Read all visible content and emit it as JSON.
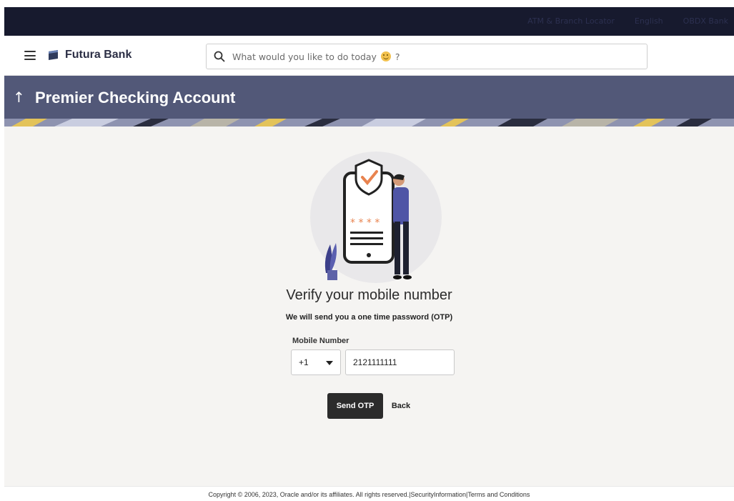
{
  "topbar": {
    "items": [
      "ATM & Branch Locator",
      "English",
      "OBDX Bank"
    ]
  },
  "header": {
    "brand": "Futura Bank",
    "search_placeholder_before": "What would you like to do today",
    "search_placeholder_after": "?"
  },
  "banner": {
    "back_glyph": "↑",
    "title": "Premier Checking Account"
  },
  "verify": {
    "heading": "Verify your mobile number",
    "subtext": "We will send you a one time password (OTP)",
    "mobile_label": "Mobile Number",
    "country_code": "+1",
    "mobile_value": "2121111111",
    "send_label": "Send OTP",
    "back_label": "Back",
    "otp_mask": "* * * *"
  },
  "footer": {
    "copyright": "Copyright © 2006, 2023, Oracle and/or its affiliates. All rights reserved.",
    "sep1": "|",
    "security": "SecurityInformation",
    "sep2": "|",
    "terms": "Terms and Conditions"
  },
  "colors": {
    "topbar": "#171a2e",
    "banner": "#525878",
    "button": "#2b2b2b",
    "accent": "#e8834f"
  }
}
